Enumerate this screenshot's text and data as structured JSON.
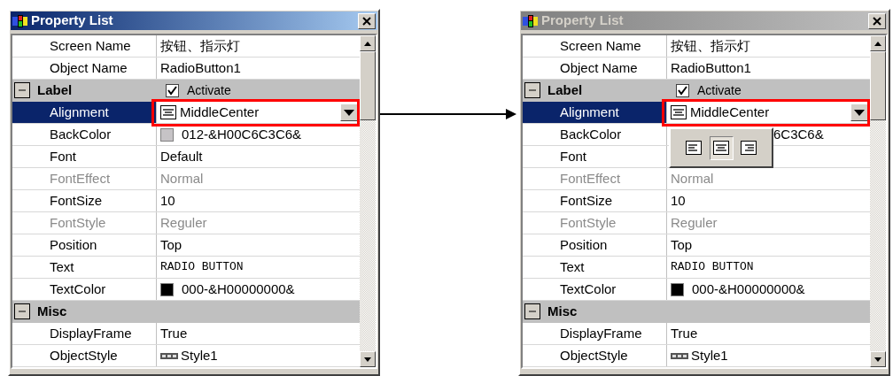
{
  "panels": [
    {
      "title": "Property List",
      "active": true,
      "rows": [
        {
          "kind": "prop",
          "name": "Screen Name",
          "value": {
            "kind": "text",
            "text": "按钮、指示灯"
          },
          "disabled": false,
          "selected": false
        },
        {
          "kind": "prop",
          "name": "Object Name",
          "value": {
            "kind": "text",
            "text": "RadioButton1"
          },
          "disabled": false,
          "selected": false
        },
        {
          "kind": "group",
          "name": "Label",
          "expanded": true,
          "check": {
            "label": "Activate",
            "checked": true
          }
        },
        {
          "kind": "prop",
          "name": "Alignment",
          "value": {
            "kind": "align",
            "text": "MiddleCenter"
          },
          "disabled": false,
          "selected": true,
          "dropdown": true,
          "highlighted": true
        },
        {
          "kind": "prop",
          "name": "BackColor",
          "value": {
            "kind": "swatch",
            "text": "012-&H00C6C3C6&",
            "color": "#c6c3c6"
          },
          "disabled": false,
          "selected": false
        },
        {
          "kind": "prop",
          "name": "Font",
          "value": {
            "kind": "text",
            "text": "Default"
          },
          "disabled": false,
          "selected": false
        },
        {
          "kind": "prop",
          "name": "FontEffect",
          "value": {
            "kind": "text",
            "text": "Normal"
          },
          "disabled": true,
          "selected": false
        },
        {
          "kind": "prop",
          "name": "FontSize",
          "value": {
            "kind": "text",
            "text": "10"
          },
          "disabled": false,
          "selected": false
        },
        {
          "kind": "prop",
          "name": "FontStyle",
          "value": {
            "kind": "text",
            "text": "Reguler"
          },
          "disabled": true,
          "selected": false
        },
        {
          "kind": "prop",
          "name": "Position",
          "value": {
            "kind": "text",
            "text": "Top"
          },
          "disabled": false,
          "selected": false
        },
        {
          "kind": "prop",
          "name": "Text",
          "value": {
            "kind": "mono",
            "text": "RADIO BUTTON"
          },
          "disabled": false,
          "selected": false
        },
        {
          "kind": "prop",
          "name": "TextColor",
          "value": {
            "kind": "swatch",
            "text": "000-&H00000000&",
            "color": "#000000"
          },
          "disabled": false,
          "selected": false
        },
        {
          "kind": "group",
          "name": "Misc",
          "expanded": true
        },
        {
          "kind": "prop",
          "name": "DisplayFrame",
          "value": {
            "kind": "text",
            "text": "True"
          },
          "disabled": false,
          "selected": false
        },
        {
          "kind": "prop",
          "name": "ObjectStyle",
          "value": {
            "kind": "style",
            "text": "Style1"
          },
          "disabled": false,
          "selected": false
        }
      ]
    },
    {
      "title": "Property List",
      "active": false,
      "popup": {
        "options": [
          {
            "kind": "left",
            "selected": false
          },
          {
            "kind": "center",
            "selected": true
          },
          {
            "kind": "right",
            "selected": false
          }
        ]
      },
      "rows": [
        {
          "kind": "prop",
          "name": "Screen Name",
          "value": {
            "kind": "text",
            "text": "按钮、指示灯"
          },
          "disabled": false,
          "selected": false
        },
        {
          "kind": "prop",
          "name": "Object Name",
          "value": {
            "kind": "text",
            "text": "RadioButton1"
          },
          "disabled": false,
          "selected": false
        },
        {
          "kind": "group",
          "name": "Label",
          "expanded": true,
          "check": {
            "label": "Activate",
            "checked": true
          }
        },
        {
          "kind": "prop",
          "name": "Alignment",
          "value": {
            "kind": "align",
            "text": "MiddleCenter"
          },
          "disabled": false,
          "selected": true,
          "dropdown": true,
          "highlighted": true
        },
        {
          "kind": "prop",
          "name": "BackColor",
          "value": {
            "kind": "covered",
            "text": "6C3C6&"
          },
          "disabled": false,
          "selected": false
        },
        {
          "kind": "prop",
          "name": "Font",
          "disabled": false,
          "selected": false
        },
        {
          "kind": "prop",
          "name": "FontEffect",
          "value": {
            "kind": "text",
            "text": "Normal"
          },
          "disabled": true,
          "selected": false
        },
        {
          "kind": "prop",
          "name": "FontSize",
          "value": {
            "kind": "text",
            "text": "10"
          },
          "disabled": false,
          "selected": false
        },
        {
          "kind": "prop",
          "name": "FontStyle",
          "value": {
            "kind": "text",
            "text": "Reguler"
          },
          "disabled": true,
          "selected": false
        },
        {
          "kind": "prop",
          "name": "Position",
          "value": {
            "kind": "text",
            "text": "Top"
          },
          "disabled": false,
          "selected": false
        },
        {
          "kind": "prop",
          "name": "Text",
          "value": {
            "kind": "mono",
            "text": "RADIO BUTTON"
          },
          "disabled": false,
          "selected": false
        },
        {
          "kind": "prop",
          "name": "TextColor",
          "value": {
            "kind": "swatch",
            "text": "000-&H00000000&",
            "color": "#000000"
          },
          "disabled": false,
          "selected": false
        },
        {
          "kind": "group",
          "name": "Misc",
          "expanded": true
        },
        {
          "kind": "prop",
          "name": "DisplayFrame",
          "value": {
            "kind": "text",
            "text": "True"
          },
          "disabled": false,
          "selected": false
        },
        {
          "kind": "prop",
          "name": "ObjectStyle",
          "value": {
            "kind": "style",
            "text": "Style1"
          },
          "disabled": false,
          "selected": false
        }
      ]
    }
  ]
}
